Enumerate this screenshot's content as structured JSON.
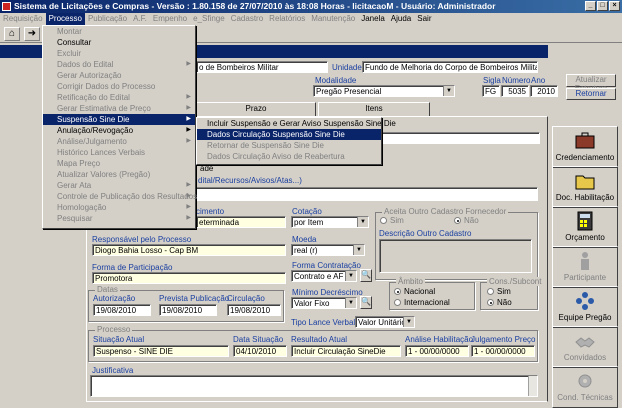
{
  "window": {
    "title": "Sistema de Licitações e Compras - Versão : 1.80.158 de 27/07/2010 às 18:08 Horas - licitacaoM - Usuário: Administrador"
  },
  "menubar": [
    {
      "label": "Requisição",
      "state": "dim"
    },
    {
      "label": "Processo",
      "state": "active"
    },
    {
      "label": "Publicação",
      "state": "dim"
    },
    {
      "label": "A.F.",
      "state": "dim"
    },
    {
      "label": "Empenho",
      "state": "dim"
    },
    {
      "label": "e_Sfinge",
      "state": "dim"
    },
    {
      "label": "Cadastro",
      "state": "dim"
    },
    {
      "label": "Relatórios",
      "state": "dim"
    },
    {
      "label": "Manutenção",
      "state": "dim"
    },
    {
      "label": "Janela",
      "state": "normal"
    },
    {
      "label": "Ajuda",
      "state": "normal"
    },
    {
      "label": "Sair",
      "state": "normal"
    }
  ],
  "process_menu": [
    {
      "label": "Montar",
      "dim": true,
      "arrow": false
    },
    {
      "label": "Consultar",
      "dim": false,
      "arrow": false
    },
    {
      "label": "Excluir",
      "dim": true,
      "arrow": false
    },
    {
      "label": "Dados do Edital",
      "dim": true,
      "arrow": true
    },
    {
      "label": "Gerar Autorização",
      "dim": true,
      "arrow": false
    },
    {
      "label": "Corrigir Dados do Processo",
      "dim": true,
      "arrow": false
    },
    {
      "label": "Retificação do Edital",
      "dim": true,
      "arrow": true
    },
    {
      "label": "Gerar Estimativa de Preço",
      "dim": true,
      "arrow": true
    },
    {
      "label": "Suspensão Sine Die",
      "dim": false,
      "arrow": true,
      "selected": true
    },
    {
      "label": "Anulação/Revogação",
      "dim": false,
      "arrow": true
    },
    {
      "label": "Análise/Julgamento",
      "dim": true,
      "arrow": true
    },
    {
      "label": "Histórico Lances Verbais",
      "dim": true,
      "arrow": false
    },
    {
      "label": "Mapa Preço",
      "dim": true,
      "arrow": false
    },
    {
      "label": "Atualizar Valores (Pregão)",
      "dim": true,
      "arrow": false
    },
    {
      "label": "Gerar Ata",
      "dim": true,
      "arrow": true
    },
    {
      "label": "Controle de Publicação dos Resultados",
      "dim": true,
      "arrow": true
    },
    {
      "label": "Homologação",
      "dim": true,
      "arrow": true
    },
    {
      "label": "Pesquisar",
      "dim": true,
      "arrow": true
    }
  ],
  "submenu": [
    {
      "label": "Incluir Suspensão e Gerar Aviso Suspensão Sine Die",
      "dim": false,
      "selected": false
    },
    {
      "label": "Dados Circulação Suspensão Sine Die",
      "dim": false,
      "selected": true
    },
    {
      "label": "Retornar de Suspensão Sine Die",
      "dim": true,
      "selected": false
    },
    {
      "label": "Dados Circulação Aviso de Reabertura",
      "dim": true,
      "selected": false
    }
  ],
  "header": {
    "orgao_value": "o de Bombeiros Militar",
    "unidade_label": "Unidade",
    "unidade_value": "Fundo de Melhoria do Corpo de Bombeiros Militar",
    "modalidade_label": "Modalidade",
    "modalidade_value": "Pregão Presencial",
    "sigla_label": "Sigla",
    "sigla_value": "FG",
    "numero_label": "Número",
    "numero_value": "5035",
    "ano_label": "Ano",
    "ano_value": "2010",
    "atualizar_label": "Atualizar Estrutura",
    "retornar_label": "Retornar"
  },
  "tabs": [
    {
      "label": "Prazo"
    },
    {
      "label": "Itens"
    }
  ],
  "form": {
    "sel_label": "ade",
    "edital_link": "dital/Recursos/Avisos/Atas...)",
    "tipo_label": "cimento",
    "tipo_value": "eterminada",
    "cotacao_label": "Cotação",
    "cotacao_value": "por Item",
    "responsavel_label": "Responsável pelo Processo",
    "responsavel_value": "Diogo Bahia Losso - Cap BM",
    "moeda_label": "Moeda",
    "moeda_value": "real (r)",
    "forma_part_label": "Forma de Participação",
    "forma_part_value": "Promotora",
    "forma_contr_label": "Forma Contratação",
    "forma_contr_value": "Contrato e AF",
    "minimo_label": "Mínimo Decréscimo",
    "minimo_value": "Valor Fixo",
    "tipo_lance_label": "Tipo Lance Verbal",
    "tipo_lance_value": "Valor Unitário",
    "aceita_title": "Aceita Outro Cadastro Fornecedor",
    "sim": "Sim",
    "nao": "Não",
    "desc_outro_label": "Descrição Outro Cadastro",
    "ambito_title": "Âmbito",
    "nacional": "Nacional",
    "internacional": "Internacional",
    "cons_title": "Cons./Subcont",
    "datas_title": "Datas",
    "autorizacao_label": "Autorização",
    "autorizacao_value": "19/08/2010",
    "previsto_label": "Prevista Publicação",
    "previsto_value": "19/08/2010",
    "circulacao_label": "Circulação",
    "circulacao_value": "19/08/2010",
    "processo_title": "Processo",
    "situacao_label": "Situação Atual",
    "situacao_value": "Suspenso - SINE DIE",
    "data_sit_label": "Data Situação",
    "data_sit_value": "04/10/2010",
    "resultado_label": "Resultado Atual",
    "resultado_value": "Incluir Circulação SineDie",
    "analise_label": "Análise Habilitação",
    "analise_value": "1 - 00/00/0000",
    "julgamento_label": "Julgamento Preço",
    "julgamento_value": "1 - 00/00/0000",
    "justificativa_label": "Justificativa"
  },
  "side_buttons": [
    {
      "label": "Credenciamento",
      "dim": false,
      "icon": "briefcase-icon"
    },
    {
      "label": "Doc. Habilitação",
      "dim": false,
      "icon": "folder-icon"
    },
    {
      "label": "Orçamento",
      "dim": false,
      "icon": "calculator-icon"
    },
    {
      "label": "Participante",
      "dim": true,
      "icon": "person-icon"
    },
    {
      "label": "Equipe Pregão",
      "dim": false,
      "icon": "team-icon"
    },
    {
      "label": "Convidados",
      "dim": true,
      "icon": "handshake-icon"
    },
    {
      "label": "Cond. Técnicas",
      "dim": true,
      "icon": "gear-icon"
    }
  ],
  "colors": {
    "titlebar": "#0a246a",
    "field_yellow": "#ffffe1",
    "label_blue": "#1a3fa0"
  }
}
